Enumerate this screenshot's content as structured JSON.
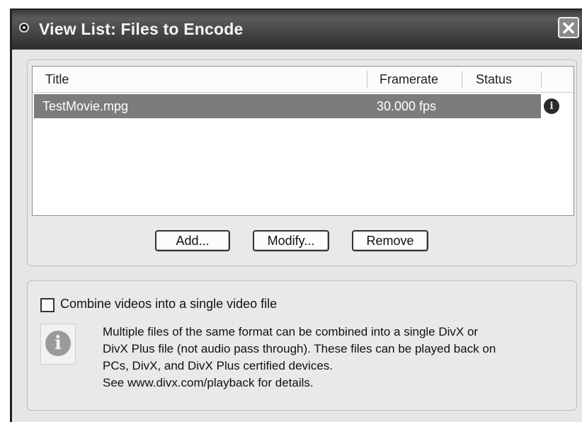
{
  "window": {
    "title": "View List: Files to Encode",
    "close_label": "✕"
  },
  "list": {
    "columns": [
      "Title",
      "Framerate",
      "Status"
    ],
    "rows": [
      {
        "title": "TestMovie.mpg",
        "framerate": "30.000 fps",
        "status_icon": "info-icon"
      }
    ]
  },
  "buttons": {
    "add": "Add...",
    "modify": "Modify...",
    "remove": "Remove"
  },
  "combine": {
    "checkbox_label": "Combine videos into a single video file",
    "checked": false,
    "info_icon": "info-icon",
    "info_lines": [
      "Multiple files of the same format can be combined into a single DivX or",
      "DivX Plus file (not audio pass through). These files can be played back on",
      "PCs, DivX, and DivX Plus certified devices.",
      "See www.divx.com/playback for details."
    ]
  },
  "colors": {
    "titlebar": "#474747",
    "selected_row": "#7c7c7c",
    "dialog_bg": "#e9e9e9"
  }
}
